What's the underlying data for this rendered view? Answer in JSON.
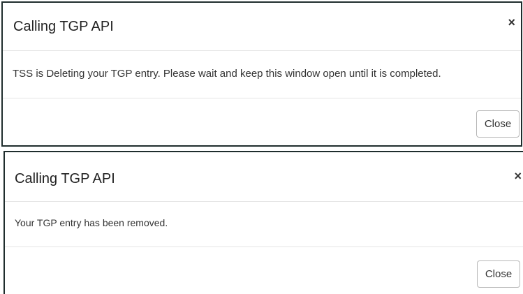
{
  "dialogs": [
    {
      "title": "Calling TGP API",
      "close_icon": "×",
      "message": "TSS is Deleting your TGP entry. Please wait and keep this window open until it is completed.",
      "close_button_label": "Close"
    },
    {
      "title": "Calling TGP API",
      "close_icon": "×",
      "message": "Your TGP entry has been removed.",
      "close_button_label": "Close"
    }
  ]
}
